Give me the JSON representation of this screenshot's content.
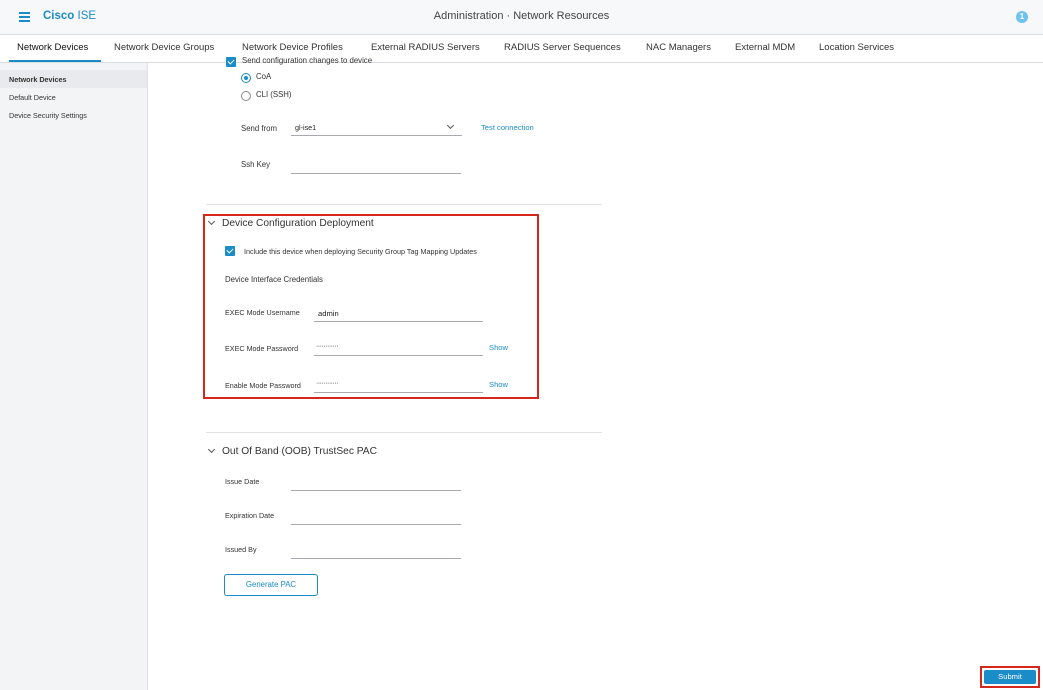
{
  "header": {
    "brand_bold": "Cisco",
    "brand_rest": " ISE",
    "title": "Administration · Network Resources",
    "notification_count": "1"
  },
  "tabs": [
    {
      "label": "Network Devices",
      "active": true
    },
    {
      "label": "Network Device Groups"
    },
    {
      "label": "Network Device Profiles"
    },
    {
      "label": "External RADIUS Servers"
    },
    {
      "label": "RADIUS Server Sequences"
    },
    {
      "label": "NAC Managers"
    },
    {
      "label": "External MDM"
    },
    {
      "label": "Location Services"
    }
  ],
  "sidebar": {
    "items": [
      {
        "label": "Network Devices",
        "active": true
      },
      {
        "label": "Default Device"
      },
      {
        "label": "Device Security Settings"
      }
    ]
  },
  "send_config": {
    "checkbox_label": "Send configuration changes to device",
    "radio_coa": "CoA",
    "radio_cli": "CLI (SSH)",
    "send_from_label": "Send from",
    "send_from_value": "gl-ise1",
    "test_connection": "Test connection",
    "ssh_key_label": "Ssh Key",
    "ssh_key_value": ""
  },
  "deployment": {
    "title": "Device Configuration Deployment",
    "include_label": "Include this device when deploying Security Group Tag Mapping Updates",
    "credentials_heading": "Device Interface Credentials",
    "exec_user_label": "EXEC Mode Username",
    "exec_user_value": "admin",
    "exec_pass_label": "EXEC Mode Password",
    "exec_pass_value": "············",
    "enable_pass_label": "Enable Mode Password",
    "enable_pass_value": "············",
    "show_label": "Show"
  },
  "oob": {
    "title": "Out Of Band (OOB) TrustSec PAC",
    "issue_date_label": "Issue Date",
    "expiration_date_label": "Expiration Date",
    "issued_by_label": "Issued By",
    "generate_pac": "Generate PAC"
  },
  "footer": {
    "submit": "Submit"
  },
  "colors": {
    "accent": "#1a8cc7",
    "highlight": "#d6271f"
  }
}
